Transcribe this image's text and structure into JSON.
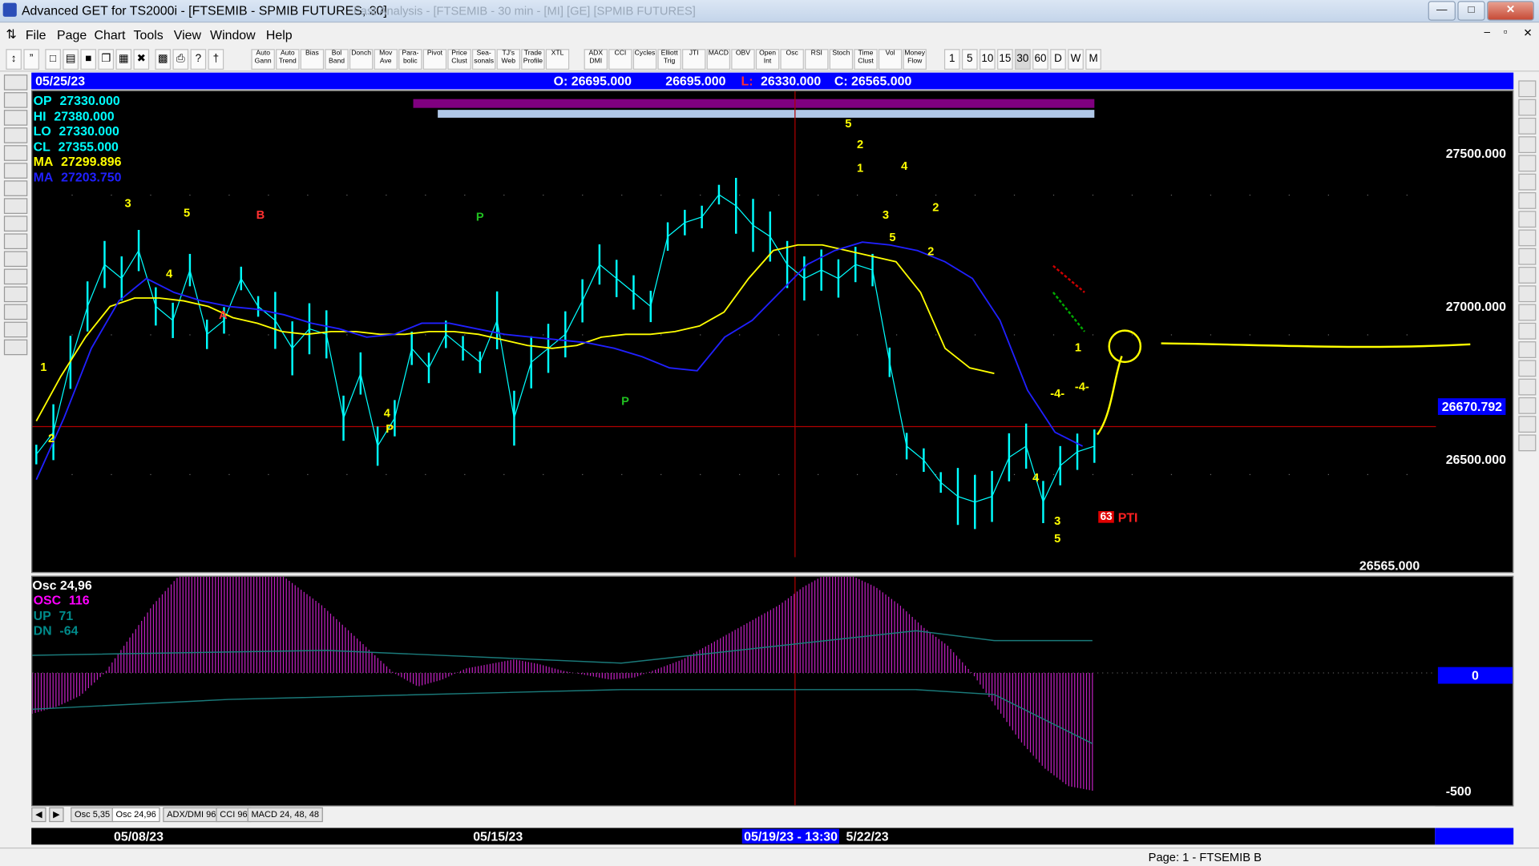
{
  "window": {
    "title": "Advanced GET for TS2000i - [FTSEMIB - SPMIB FUTURES, 30]",
    "background_title": "Fast Analysis - [FTSEMIB - 30 min - [MI] [GE] [SPMIB FUTURES]"
  },
  "menu": [
    "File",
    "Page",
    "Chart",
    "Tools",
    "View",
    "Window",
    "Help"
  ],
  "toolbar": {
    "studies": [
      "Auto Gann",
      "Auto Trend",
      "Bias",
      "Bol Band",
      "Donch",
      "Mov Ave",
      "Para-bolic",
      "Pivot",
      "Price Clust",
      "Sea-sonals",
      "TJ's Web",
      "Trade Profile",
      "XTL",
      "ADX DMI",
      "CCI",
      "Cycles",
      "Elliott Trig",
      "JTI",
      "MACD",
      "OBV",
      "Open Int",
      "Osc",
      "RSI",
      "Stoch",
      "Time Clust",
      "Vol",
      "Money Flow"
    ],
    "intervals": [
      "1",
      "5",
      "10",
      "15",
      "30",
      "60",
      "D",
      "W",
      "M"
    ]
  },
  "header": {
    "date": "05/25/23",
    "open": "O: 26695.000",
    "high": "26695.000",
    "low_label": "L:",
    "low": "26330.000",
    "close": "C: 26565.000"
  },
  "info_panel": [
    {
      "label": "OP",
      "value": "27330.000",
      "color": "#00ffff"
    },
    {
      "label": "HI",
      "value": "27380.000",
      "color": "#00ffff"
    },
    {
      "label": "LO",
      "value": "27330.000",
      "color": "#00ffff"
    },
    {
      "label": "CL",
      "value": "27355.000",
      "color": "#00ffff"
    },
    {
      "label": "MA",
      "value": "27299.896",
      "color": "#ffff00"
    },
    {
      "label": "MA",
      "value": "27203.750",
      "color": "#2020ff"
    }
  ],
  "price_axis": {
    "labels": [
      "27500.000",
      "27000.000",
      "26500.000"
    ],
    "current": "26670.792",
    "last": "26565.000"
  },
  "annotations": {
    "pti_value": "63",
    "pti_label": "PTI",
    "wave_labels": [
      "1",
      "2",
      "3",
      "5",
      "4",
      "A",
      "B",
      "P",
      "4",
      "P",
      "P",
      "5",
      "2",
      "1",
      "4",
      "3",
      "5",
      "2",
      "2",
      "1",
      "-4-",
      "-4-",
      "4",
      "3",
      "5"
    ]
  },
  "osc_panel": {
    "title": "Osc 24,96",
    "lines": [
      {
        "label": "OSC",
        "value": "116",
        "color": "#ff00ff"
      },
      {
        "label": "UP",
        "value": "71",
        "color": "#008b8b"
      },
      {
        "label": "DN",
        "value": "-64",
        "color": "#008b8b"
      }
    ],
    "axis": {
      "zero": "0",
      "low": "-500"
    }
  },
  "tabs": [
    "Osc 5,35",
    "Osc 24,96",
    "ADX/DMI 96",
    "CCI 96",
    "MACD 24, 48, 48"
  ],
  "dates": {
    "d1": "05/08/23",
    "d2": "05/15/23",
    "cursor": "05/19/23 - 13:30",
    "d3": "5/22/23"
  },
  "status": {
    "page": "Page: 1 - FTSEMIB B"
  },
  "chart_data": {
    "type": "line",
    "title": "FTSEMIB - SPMIB FUTURES, 30",
    "ylim": [
      26150,
      27870
    ],
    "x_dates": [
      "05/08/23",
      "05/15/23",
      "05/19/23 - 13:30",
      "5/22/23"
    ],
    "series": [
      {
        "name": "price",
        "color": "#00ffff",
        "values": [
          26570,
          26650,
          26900,
          27100,
          27250,
          27200,
          27300,
          27100,
          27050,
          27230,
          27000,
          27050,
          27200,
          27100,
          27050,
          26950,
          27020,
          27000,
          26700,
          26860,
          26600,
          26700,
          26950,
          26880,
          27000,
          26950,
          26900,
          27050,
          26700,
          26900,
          26950,
          27000,
          27120,
          27250,
          27200,
          27150,
          27100,
          27350,
          27400,
          27420,
          27500,
          27460,
          27390,
          27350,
          27250,
          27200,
          27230,
          27200,
          27250,
          27230,
          26900,
          26600,
          26550,
          26470,
          26420,
          26400,
          26420,
          26560,
          26600,
          26400,
          26530,
          26580,
          26600
        ]
      },
      {
        "name": "MA",
        "color": "#ffff00",
        "values": [
          26690,
          26850,
          26990,
          27100,
          27130,
          27130,
          27120,
          27100,
          27060,
          27040,
          27010,
          27000,
          27010,
          27010,
          27000,
          27000,
          27010,
          27010,
          27000,
          26980,
          26960,
          26950,
          26960,
          26990,
          27000,
          27000,
          27010,
          27030,
          27080,
          27200,
          27300,
          27320,
          27320,
          27300,
          27280,
          27260,
          27150,
          26950,
          26880,
          26860
        ]
      },
      {
        "name": "MA",
        "color": "#2020ff",
        "values": [
          26480,
          26700,
          26950,
          27120,
          27200,
          27150,
          27120,
          27100,
          27090,
          27070,
          27040,
          27020,
          26990,
          27000,
          27040,
          27040,
          27020,
          27000,
          26990,
          26980,
          26970,
          26950,
          26920,
          26880,
          26870,
          26990,
          27050,
          27150,
          27250,
          27300,
          27330,
          27320,
          27300,
          27260,
          27200,
          27050,
          26800,
          26650,
          26600
        ]
      }
    ],
    "oscillator": {
      "name": "OSC",
      "color": "#ff00ff",
      "values": [
        -180,
        -150,
        -100,
        0,
        150,
        300,
        420,
        500,
        550,
        520,
        460,
        380,
        300,
        200,
        100,
        0,
        -60,
        -30,
        20,
        40,
        60,
        40,
        10,
        -10,
        -30,
        -20,
        20,
        60,
        120,
        180,
        240,
        300,
        380,
        440,
        430,
        380,
        300,
        200,
        120,
        0,
        -150,
        -300,
        -420,
        -500,
        -520
      ]
    }
  }
}
